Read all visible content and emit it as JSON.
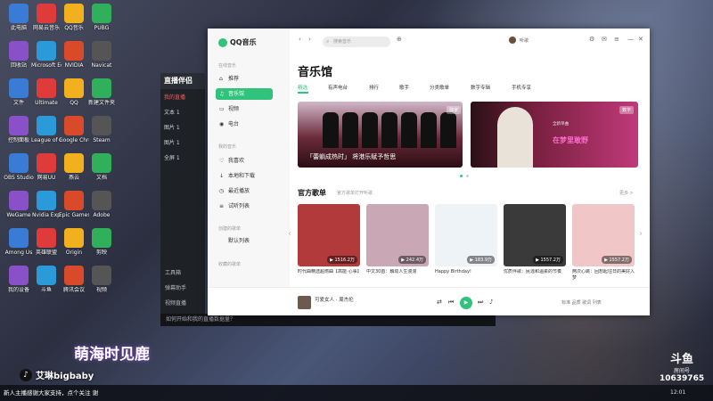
{
  "desktop": {
    "icons": [
      "此电脑",
      "网易云音乐",
      "QQ音乐",
      "PUBG",
      "回收站",
      "Microsoft Edge",
      "NVIDIA",
      "Navicat",
      "文件",
      "Ultimate",
      "QQ",
      "新建文件夹",
      "控制面板",
      "League of Legends",
      "Google Chrome",
      "Steam",
      "OBS Studio",
      "网易UU",
      "燕云",
      "文档",
      "WeGame",
      "Nvidia Exp",
      "Epic Games",
      "Adobe",
      "Among Us",
      "英雄联盟",
      "Origin",
      "剪映",
      "我的设备",
      "斗鱼",
      "腾讯会议",
      "视频"
    ]
  },
  "live_app": {
    "brand": "直播伴侣",
    "rows": [
      "我的直播",
      "文本 1",
      "图片 1",
      "图片 1",
      "全屏 1"
    ],
    "tools": [
      "工具箱",
      "弹幕助手",
      "视频直播",
      "直播间",
      "互动"
    ],
    "bottom": "如何开始和我的直播数据量？"
  },
  "qq": {
    "app_name": "QQ音乐",
    "search_placeholder": "搜索音乐",
    "user": "听歌",
    "sections": {
      "online": "在线音乐",
      "mine": "我的音乐",
      "created": "创建的歌单",
      "collected": "收藏的歌单"
    },
    "nav_online": [
      {
        "label": "推荐",
        "icon": "home-icon"
      },
      {
        "label": "音乐馆",
        "icon": "music-icon"
      },
      {
        "label": "视频",
        "icon": "video-icon"
      },
      {
        "label": "电台",
        "icon": "radio-icon"
      }
    ],
    "nav_mine": [
      {
        "label": "我喜欢",
        "icon": "heart-icon"
      },
      {
        "label": "本地和下载",
        "icon": "download-icon"
      },
      {
        "label": "最近播放",
        "icon": "clock-icon"
      },
      {
        "label": "试听列表",
        "icon": "list-icon"
      }
    ],
    "nav_created": [
      {
        "label": "默认列表"
      }
    ],
    "page_title": "音乐馆",
    "tabs": [
      "精选",
      "有声电台",
      "排行",
      "歌手",
      "分类歌单",
      "数字专辑",
      "手机专享"
    ],
    "banners": [
      {
        "caption": "「蕾躺成热时」 将港乐赋予哲思",
        "badge": "独家"
      },
      {
        "caption": "在梦里敢野",
        "subtitle": "全新单曲",
        "badge": "数字"
      }
    ],
    "playlist_section": {
      "title": "官方歌单",
      "subtitle": "官方歌单打开听歌",
      "more": "更多 >"
    },
    "playlists": [
      {
        "plays": "1516.2万",
        "name": "时代曲精选超燃曲【高能·心事】",
        "color": "#b33a3a"
      },
      {
        "plays": "242.4万",
        "name": "中文30首：触动人生漫漫",
        "color": "#c9a7b5"
      },
      {
        "plays": "183.9万",
        "name": "Happy Birthday!",
        "color": "#eef3f8"
      },
      {
        "plays": "1557.2万",
        "name": "优质伴歌：民谣和温柔的节奏",
        "color": "#3a3a3a"
      },
      {
        "plays": "1557.2万",
        "name": "两次心跳：回想起往日的美好入梦",
        "color": "#f0c6c6"
      }
    ],
    "player": {
      "song": "可爱女人",
      "artist": "周杰伦",
      "right": "标准 品质 歌词 列表"
    }
  },
  "overlay": {
    "streamer_title": "萌海时见鹿",
    "tiktok": "艾琳bigbaby",
    "douyu_logo": "斗鱼",
    "douyu_room_label": "房间号",
    "douyu_room": "10639765",
    "ticker": "新人主播感谢大家支持，点个关注 谢",
    "clock": "12:01"
  },
  "colors": {
    "accent": "#31c27c"
  }
}
